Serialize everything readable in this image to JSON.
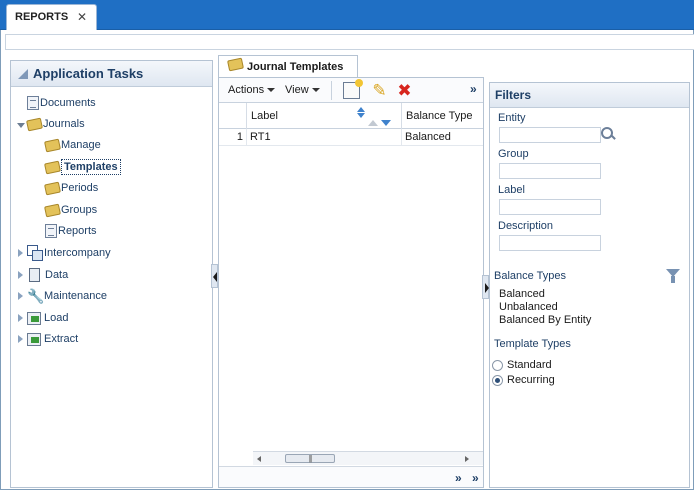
{
  "top_tab": {
    "label": "REPORTS",
    "close": "✕"
  },
  "left_panel": {
    "title": "Application Tasks",
    "tree": [
      {
        "label": "Documents"
      },
      {
        "label": "Journals"
      },
      {
        "label": "Manage"
      },
      {
        "label": "Templates"
      },
      {
        "label": "Periods"
      },
      {
        "label": "Groups"
      },
      {
        "label": "Reports"
      },
      {
        "label": "Intercompany"
      },
      {
        "label": "Data"
      },
      {
        "label": "Maintenance"
      },
      {
        "label": "Load"
      },
      {
        "label": "Extract"
      }
    ],
    "selected": "Templates"
  },
  "center": {
    "tab_label": "Journal Templates",
    "toolbar": {
      "actions_label": "Actions",
      "view_label": "View",
      "overflow": "»"
    },
    "columns": [
      {
        "label": "Label"
      },
      {
        "label": "Balance Type"
      }
    ],
    "rows": [
      {
        "index": "1",
        "label": "RT1",
        "balance_type": "Balanced"
      }
    ],
    "scroll_thumb": "|||",
    "footer_overflow": "»"
  },
  "filters": {
    "title": "Filters",
    "entity_label": "Entity",
    "group_label": "Group",
    "label_label": "Label",
    "description_label": "Description",
    "balance_types_label": "Balance Types",
    "balance_types": [
      "Balanced",
      "Unbalanced",
      "Balanced By Entity"
    ],
    "template_types_label": "Template Types",
    "template_types": [
      {
        "label": "Standard",
        "checked": false
      },
      {
        "label": "Recurring",
        "checked": true
      }
    ]
  },
  "colors": {
    "topbar": "#1f6fc4",
    "header_text": "#1e3f66",
    "delete_red": "#d7261e",
    "edit_yellow": "#d9a520"
  }
}
